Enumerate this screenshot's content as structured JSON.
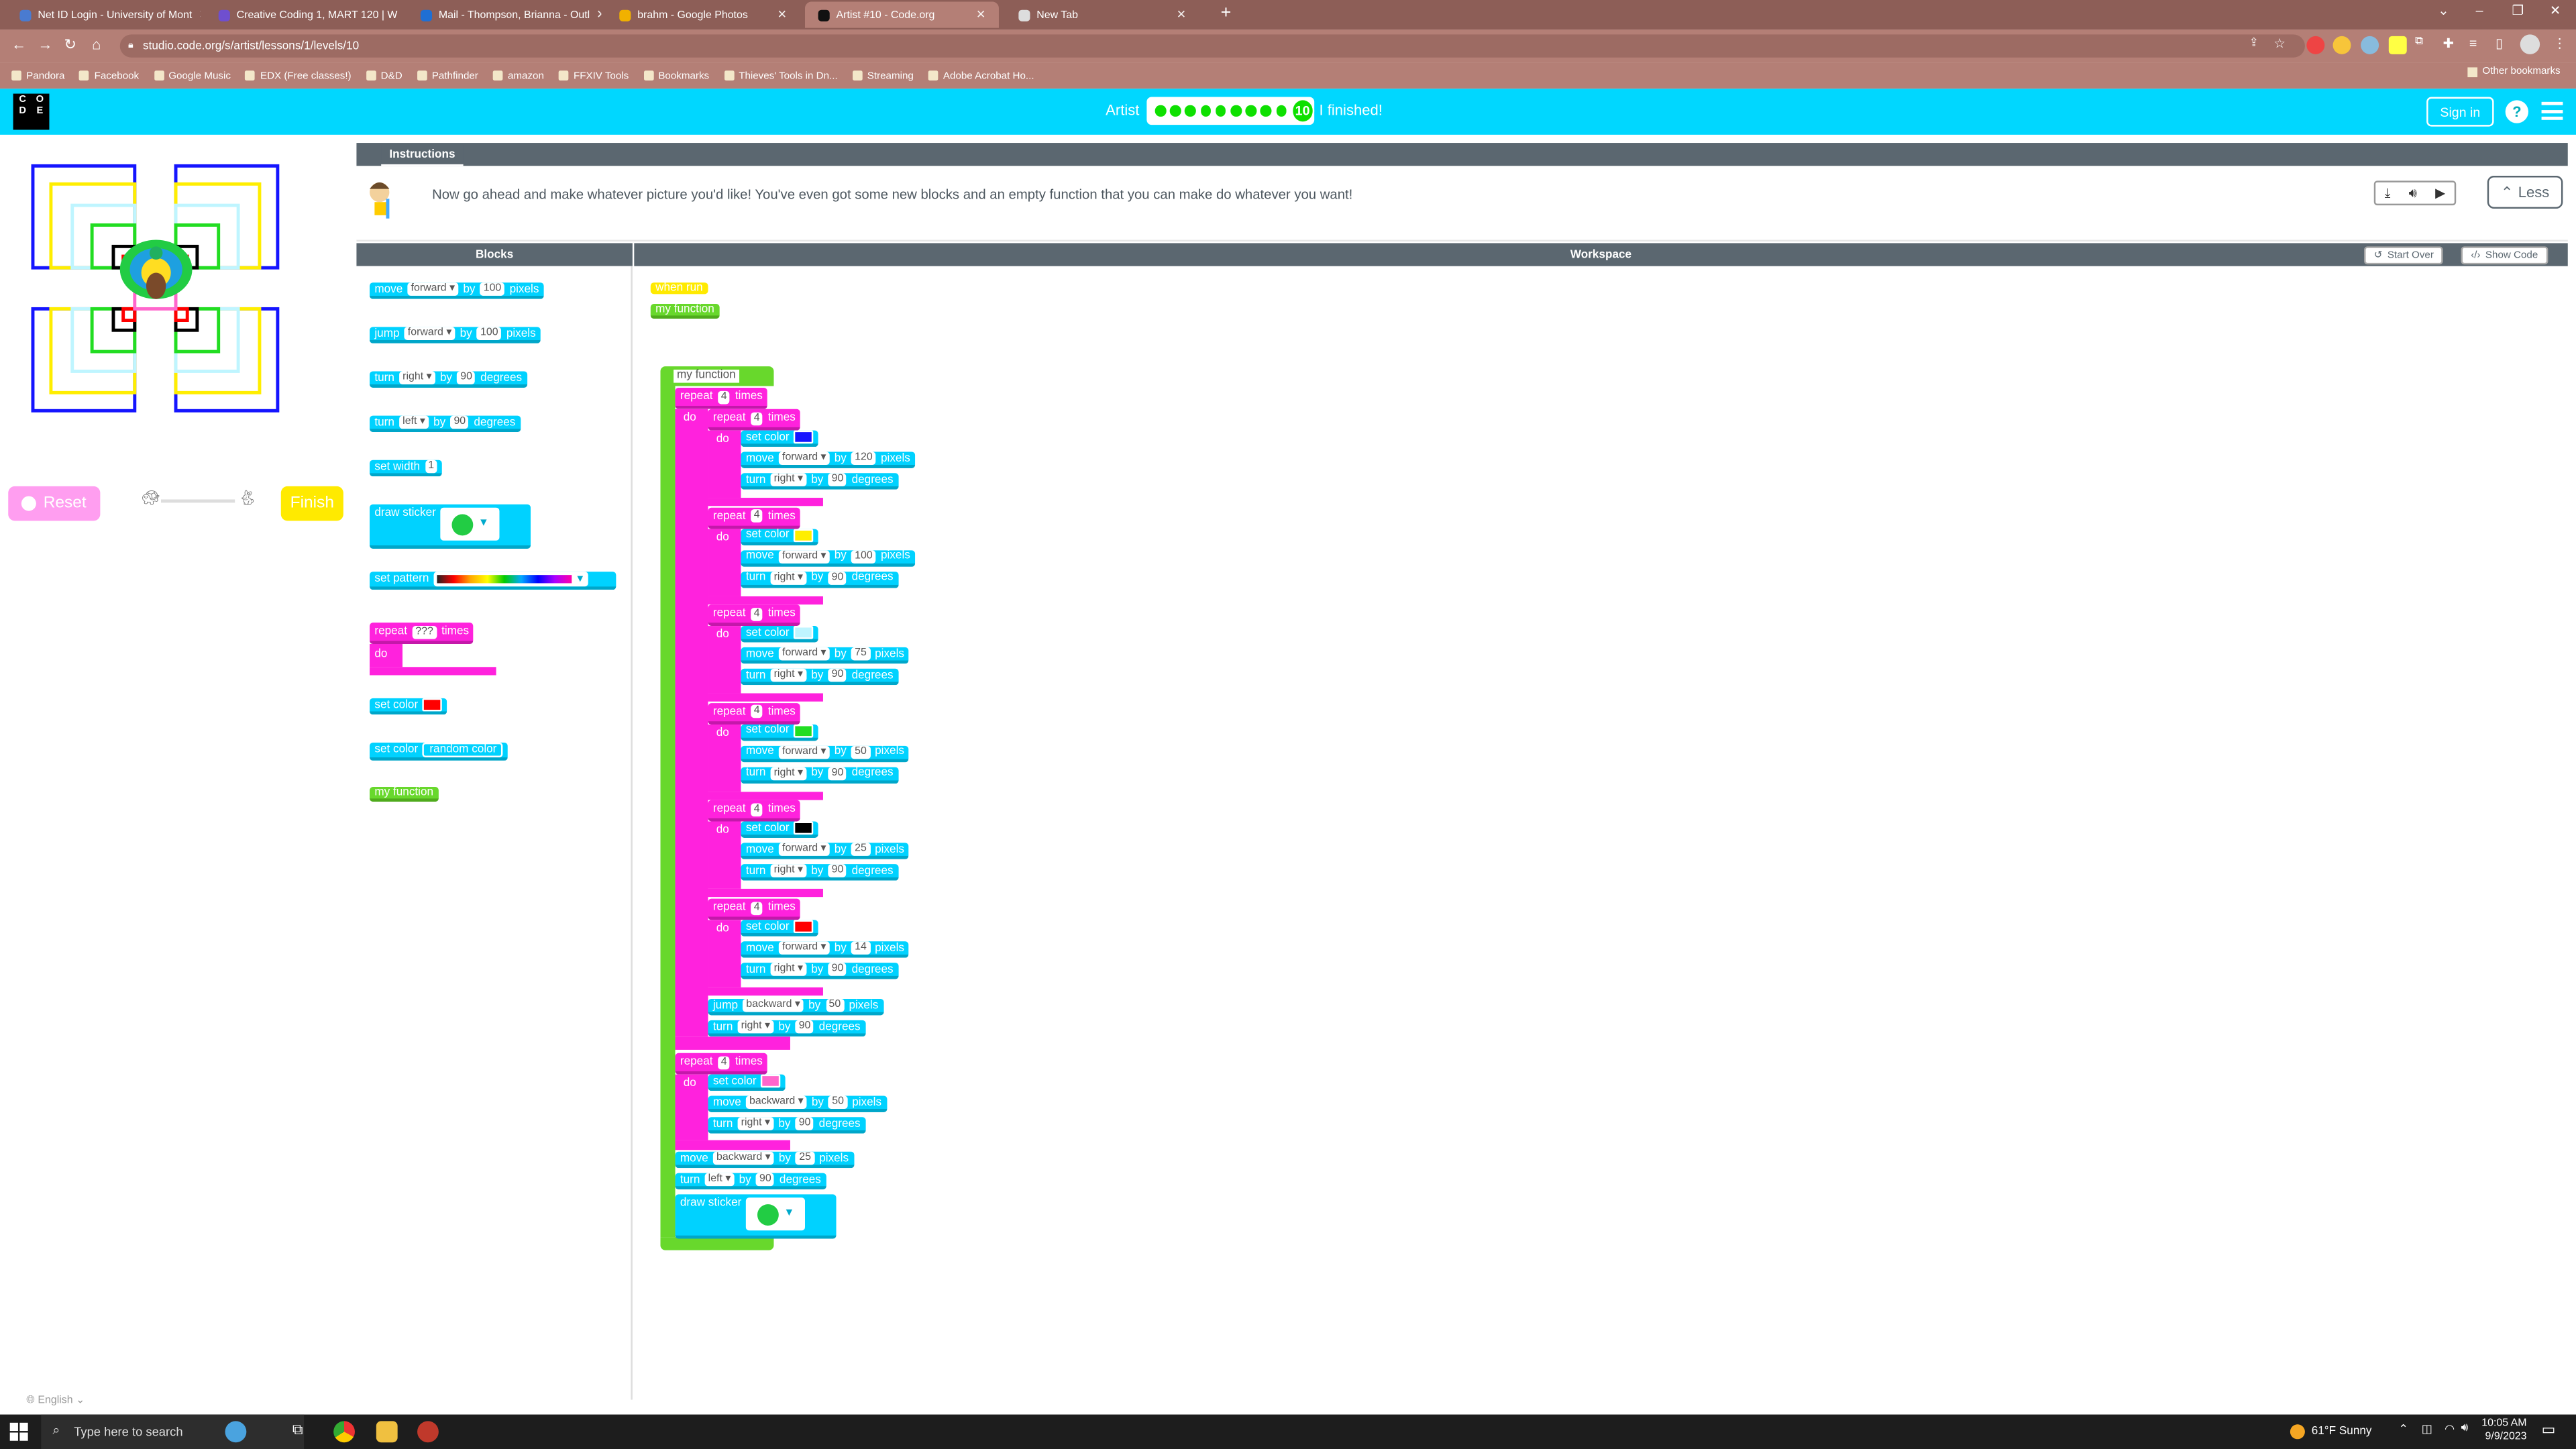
{
  "browser": {
    "tabs": [
      {
        "title": "Net ID Login - University of Mont",
        "color": "#4a7bd0",
        "active": false
      },
      {
        "title": "Creative Coding 1, MART 120 | W",
        "color": "#6f4fcf",
        "active": false
      },
      {
        "title": "Mail - Thompson, Brianna - Outl",
        "color": "#1f6fd4",
        "active": false
      },
      {
        "title": "brahm - Google Photos",
        "color": "#f1b100",
        "active": false
      },
      {
        "title": "Artist #10 - Code.org",
        "color": "#111111",
        "active": true
      },
      {
        "title": "New Tab",
        "color": "#dddddd",
        "active": false
      }
    ],
    "url": "studio.code.org/s/artist/lessons/1/levels/10",
    "bookmarks": [
      "Pandora",
      "Facebook",
      "Google Music",
      "EDX (Free classes!)",
      "D&D",
      "Pathfinder",
      "amazon",
      "FFXIV Tools",
      "Bookmarks",
      "Thieves' Tools in Dn...",
      "Streaming",
      "Adobe Acrobat Ho..."
    ],
    "other_bookmarks": "Other bookmarks"
  },
  "header": {
    "logo_letters": [
      "C",
      "O",
      "D",
      "E"
    ],
    "progress_label": "Artist",
    "current_level": "10",
    "finished_text": "I finished!",
    "signin": "Sign in",
    "help": "?"
  },
  "viz": {
    "reset": "Reset",
    "finish": "Finish"
  },
  "instructions": {
    "tab": "Instructions",
    "text": "Now go ahead and make whatever picture you'd like! You've even got some new blocks and an empty function that you can make do whatever you want!",
    "less": "Less"
  },
  "workspace": {
    "blocks_title": "Blocks",
    "workspace_title": "Workspace",
    "start_over": "Start Over",
    "show_code": "Show Code"
  },
  "toolbox": {
    "move": {
      "verb": "move",
      "dir": "forward",
      "by": "by",
      "val": "100",
      "unit": "pixels"
    },
    "jump": {
      "verb": "jump",
      "dir": "forward",
      "by": "by",
      "val": "100",
      "unit": "pixels"
    },
    "turn_right": {
      "verb": "turn",
      "dir": "right",
      "by": "by",
      "val": "90",
      "unit": "degrees"
    },
    "turn_left": {
      "verb": "turn",
      "dir": "left",
      "by": "by",
      "val": "90",
      "unit": "degrees"
    },
    "set_width": {
      "label": "set width",
      "val": "1"
    },
    "draw_sticker": "draw sticker",
    "set_pattern": "set pattern",
    "repeat": {
      "label": "repeat",
      "val": "???",
      "times": "times",
      "do": "do"
    },
    "set_color": "set color",
    "set_color_random": {
      "label": "set color",
      "val": "random color"
    },
    "my_function": "my function"
  },
  "program": {
    "when_run": "when run",
    "call_fn": "my function",
    "def_fn": "my function",
    "outer_repeat": "4",
    "inner_loops": [
      {
        "color": "#1515ff",
        "dist": "120"
      },
      {
        "color": "#ffee00",
        "dist": "100"
      },
      {
        "color": "#bff5ff",
        "dist": "75"
      },
      {
        "color": "#22dd22",
        "dist": "50"
      },
      {
        "color": "#000000",
        "dist": "25"
      },
      {
        "color": "#ff0000",
        "dist": "14"
      }
    ],
    "inner_repeat": "4",
    "turn_val": "90",
    "jump_back": "50",
    "second_repeat": {
      "count": "4",
      "color": "#ff66cc",
      "dist": "50"
    },
    "final_move": "25",
    "final_turn": "90",
    "words": {
      "repeat": "repeat",
      "times": "times",
      "do": "do",
      "set_color": "set color",
      "move": "move",
      "forward": "forward",
      "backward": "backward",
      "by": "by",
      "pixels": "pixels",
      "turn": "turn",
      "right": "right",
      "left": "left",
      "degrees": "degrees",
      "jump": "jump",
      "draw_sticker": "draw sticker"
    }
  },
  "footer": {
    "language": "English"
  },
  "taskbar": {
    "search_placeholder": "Type here to search",
    "weather": "61°F  Sunny",
    "time": "10:05 AM",
    "date": "9/9/2023"
  }
}
